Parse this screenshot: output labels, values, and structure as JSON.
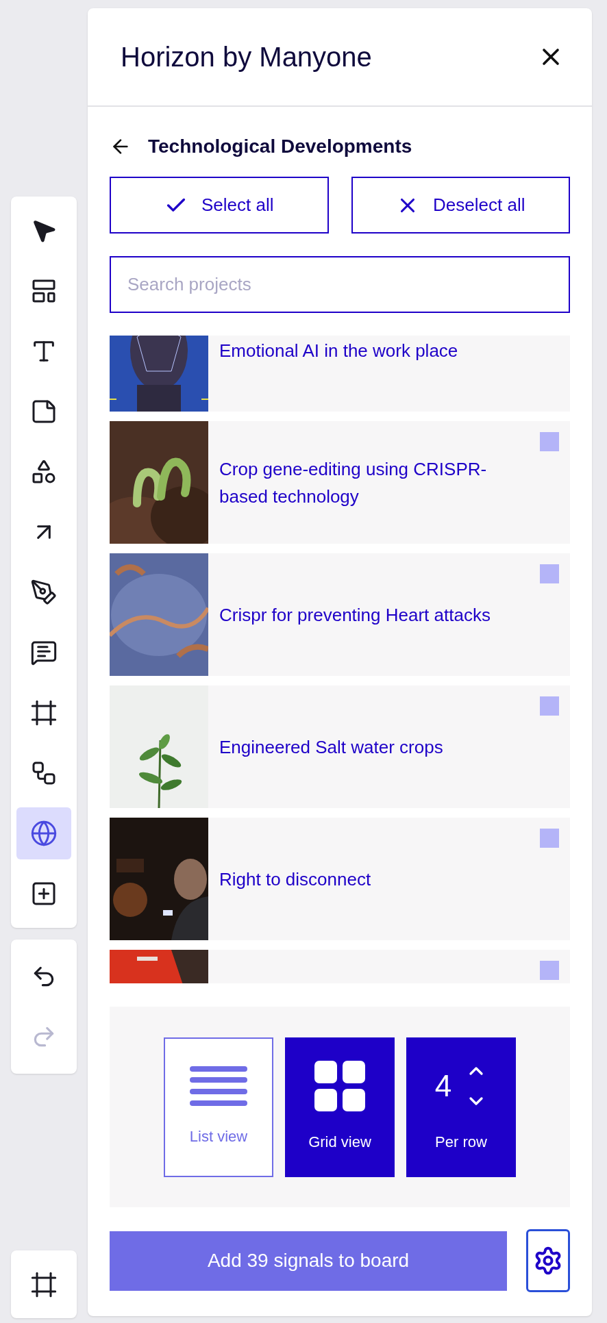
{
  "toolbar": {
    "tools": [
      {
        "kind": "pointer",
        "selected": false
      },
      {
        "kind": "layout",
        "selected": false
      },
      {
        "kind": "text",
        "selected": false
      },
      {
        "kind": "sticky",
        "selected": false
      },
      {
        "kind": "shapes",
        "selected": false
      },
      {
        "kind": "arrow",
        "selected": false
      },
      {
        "kind": "pen",
        "selected": false
      },
      {
        "kind": "comment",
        "selected": false
      },
      {
        "kind": "frame",
        "selected": false
      },
      {
        "kind": "flow",
        "selected": false
      },
      {
        "kind": "globe",
        "selected": true
      },
      {
        "kind": "add",
        "selected": false
      }
    ],
    "history": [
      {
        "kind": "undo",
        "disabled": false
      },
      {
        "kind": "redo",
        "disabled": true
      }
    ]
  },
  "panel": {
    "title": "Horizon by Manyone",
    "section": "Technological Developments",
    "select_all": "Select all",
    "deselect_all": "Deselect all",
    "search": {
      "placeholder": "Search projects"
    },
    "projects": [
      {
        "title": "Emotional AI in the work place"
      },
      {
        "title": "Crop gene-editing using CRISPR-based technology",
        "checked": false
      },
      {
        "title": "Crispr for preventing Heart attacks",
        "checked": false
      },
      {
        "title": "Engineered Salt water crops",
        "checked": false
      },
      {
        "title": "Right to disconnect",
        "checked": false
      },
      {
        "checked": false
      }
    ],
    "views": [
      {
        "kind": "list",
        "label": "List view",
        "selected": false
      },
      {
        "kind": "grid",
        "label": "Grid view",
        "selected": true
      },
      {
        "kind": "per_row",
        "label": "Per row",
        "value": "4"
      }
    ],
    "add_button": "Add 39 signals to board"
  }
}
